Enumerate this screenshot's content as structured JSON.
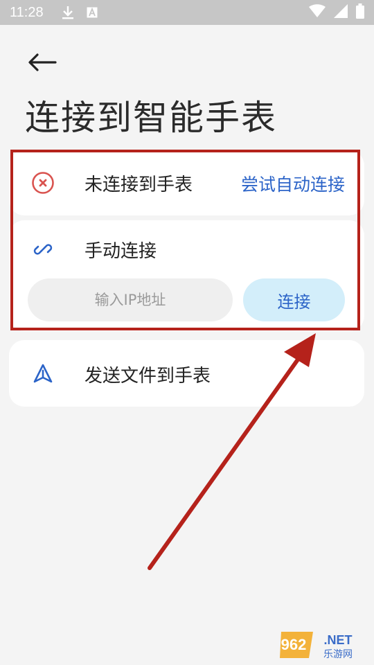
{
  "status_bar": {
    "time": "11:28",
    "icons": [
      "download-icon",
      "font-a-icon",
      "wifi-icon",
      "signal-icon",
      "battery-icon"
    ]
  },
  "header": {
    "back_icon": "arrow-left-icon",
    "title": "连接到智能手表"
  },
  "status_card": {
    "icon": "error-circle-icon",
    "icon_color": "#d9534f",
    "text": "未连接到手表",
    "action_label": "尝试自动连接"
  },
  "manual_card": {
    "icon": "link-icon",
    "title": "手动连接",
    "ip_placeholder": "输入IP地址",
    "ip_value": "",
    "connect_label": "连接"
  },
  "send_card": {
    "icon": "send-triangle-icon",
    "text": "发送文件到手表"
  },
  "annotation": {
    "color": "#b5221b"
  },
  "watermark": {
    "brand": "962.NET",
    "subtitle": "乐游网"
  },
  "colors": {
    "accent": "#2c64c8",
    "connect_bg": "#d3eefa",
    "background": "#f4f4f4"
  }
}
